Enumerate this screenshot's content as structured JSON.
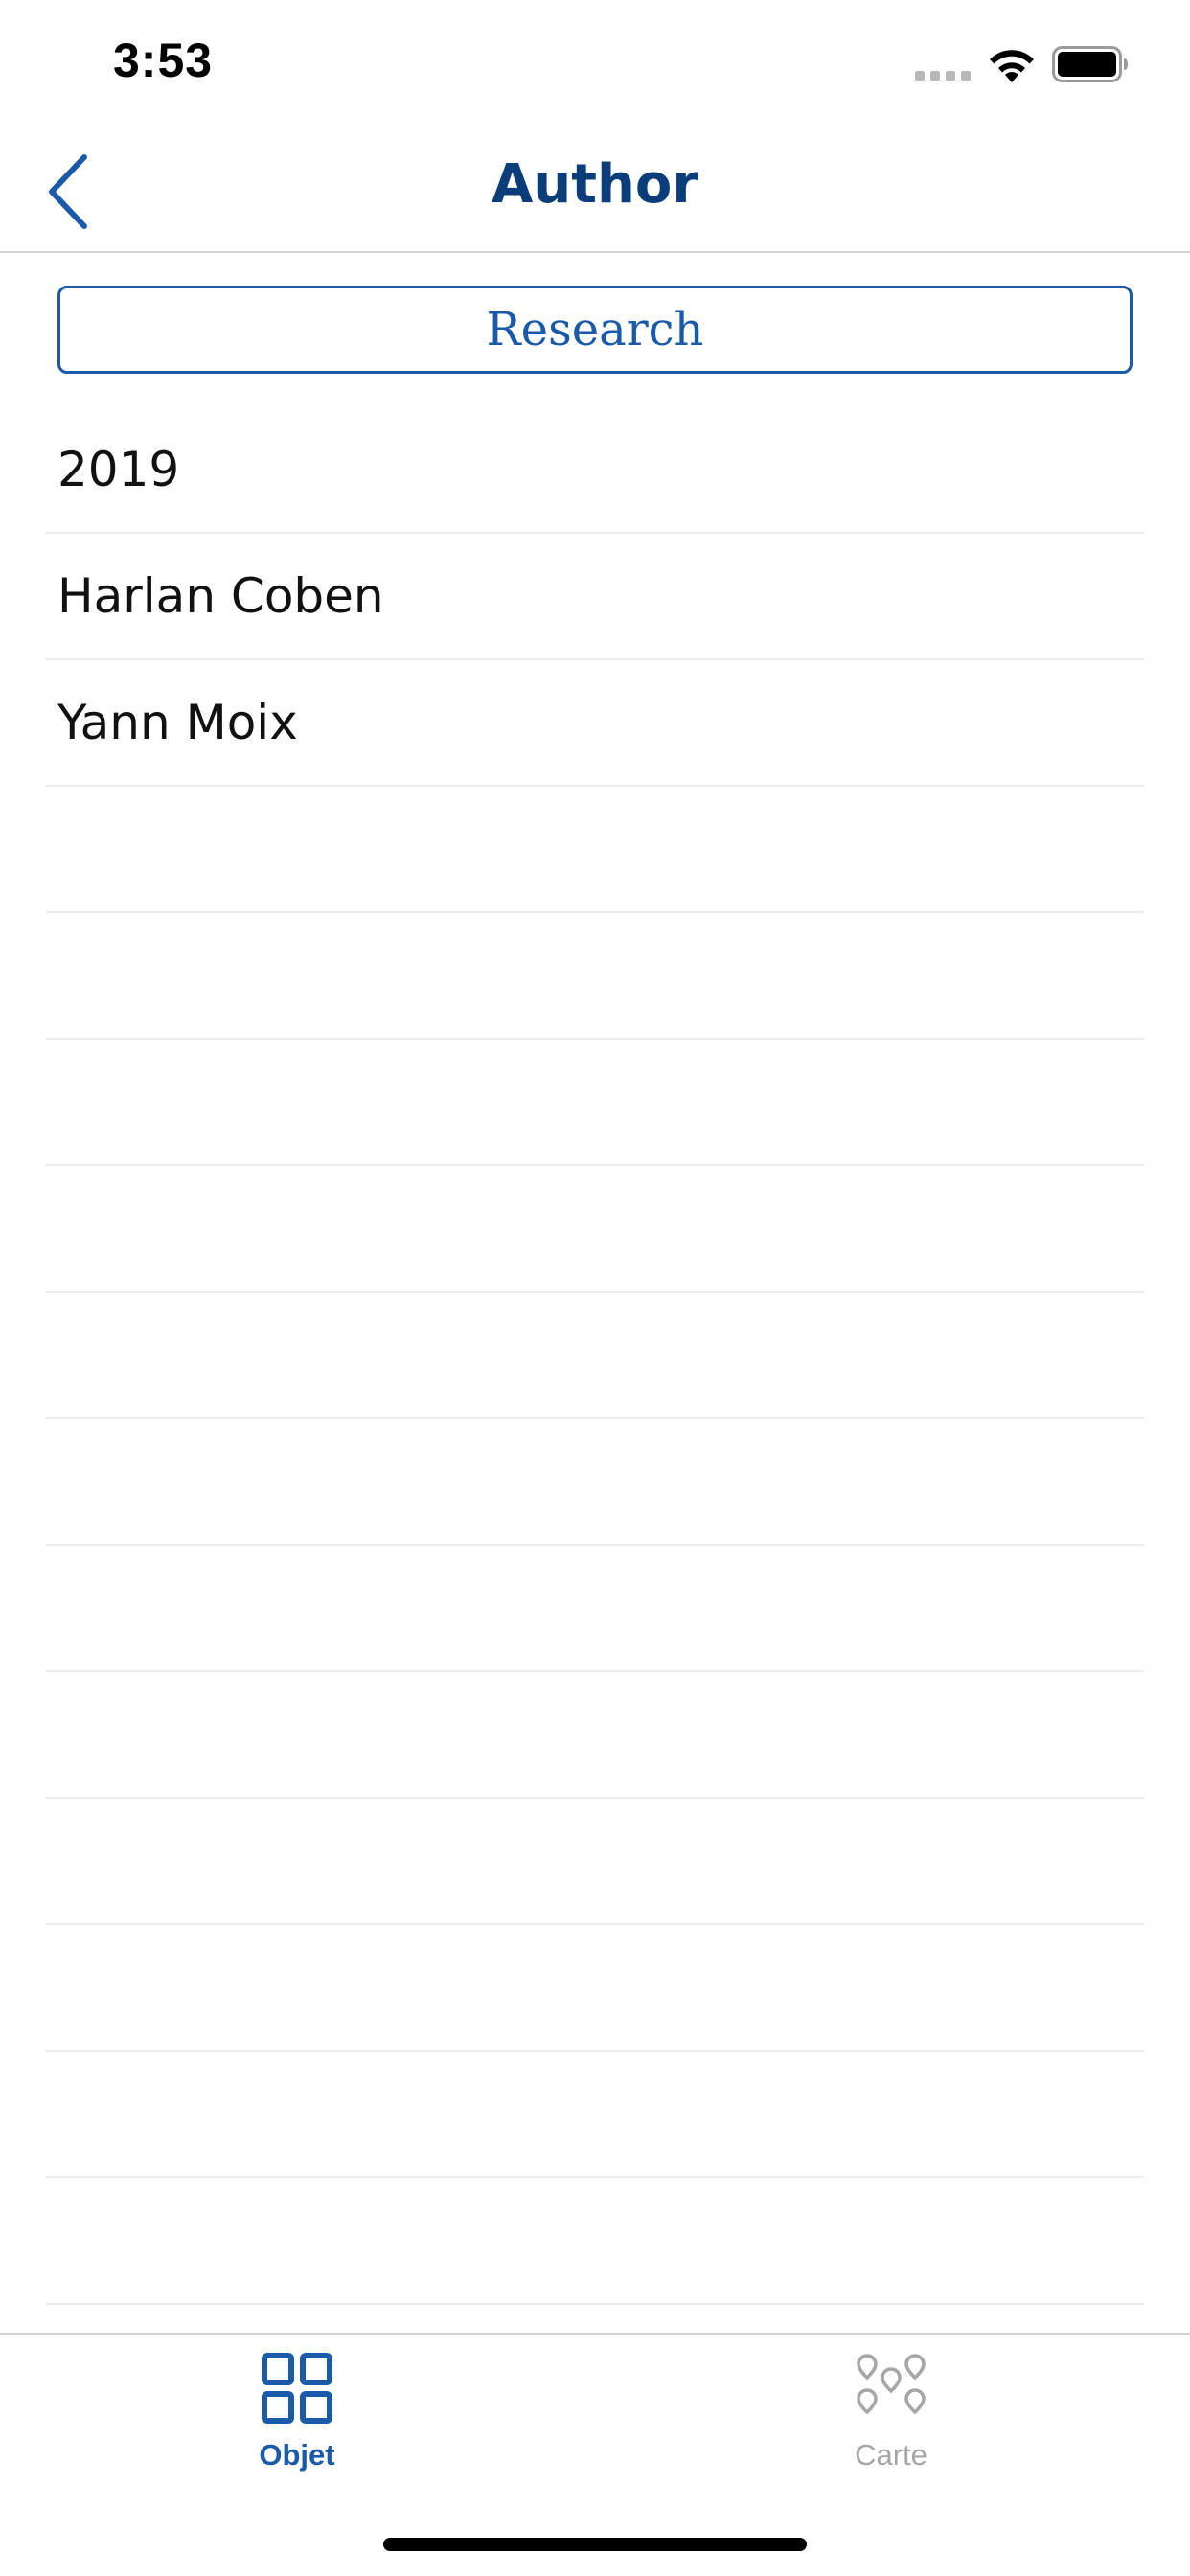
{
  "status_bar": {
    "time": "3:53"
  },
  "nav": {
    "title": "Author",
    "back_icon": "chevron-left-icon"
  },
  "research_button": {
    "label": "Research"
  },
  "list": {
    "items": [
      {
        "label": "2019"
      },
      {
        "label": "Harlan Coben"
      },
      {
        "label": "Yann Moix"
      },
      {
        "label": ""
      },
      {
        "label": ""
      },
      {
        "label": ""
      },
      {
        "label": ""
      },
      {
        "label": ""
      },
      {
        "label": ""
      },
      {
        "label": ""
      },
      {
        "label": ""
      },
      {
        "label": ""
      },
      {
        "label": ""
      },
      {
        "label": ""
      },
      {
        "label": ""
      }
    ]
  },
  "tab_bar": {
    "tabs": [
      {
        "label": "Objet",
        "icon": "grid-icon",
        "selected": true
      },
      {
        "label": "Carte",
        "icon": "map-pins-icon",
        "selected": false
      }
    ]
  },
  "colors": {
    "accent": "#1a5aa8",
    "title": "#0b3d7a",
    "inactive": "#a6a6a6"
  }
}
